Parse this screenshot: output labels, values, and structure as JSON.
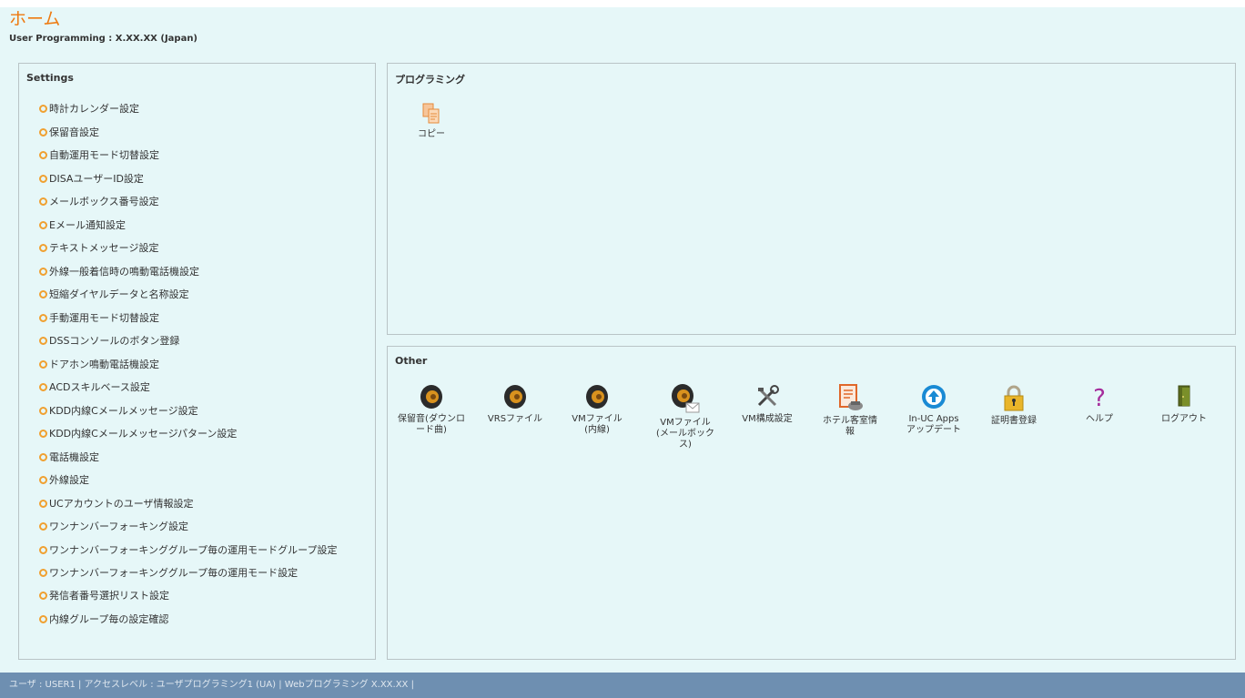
{
  "header": {
    "title": "ホーム",
    "subtitle": "User Programming : X.XX.XX (Japan)"
  },
  "settings": {
    "title": "Settings",
    "items": [
      {
        "label": "時計カレンダー設定"
      },
      {
        "label": "保留音設定"
      },
      {
        "label": "自動運用モード切替設定"
      },
      {
        "label": "DISAユーザーID設定"
      },
      {
        "label": "メールボックス番号設定"
      },
      {
        "label": "Eメール通知設定"
      },
      {
        "label": "テキストメッセージ設定"
      },
      {
        "label": "外線一般着信時の鳴動電話機設定"
      },
      {
        "label": "短縮ダイヤルデータと名称設定"
      },
      {
        "label": "手動運用モード切替設定"
      },
      {
        "label": "DSSコンソールのボタン登録"
      },
      {
        "label": "ドアホン鳴動電話機設定"
      },
      {
        "label": "ACDスキルベース設定"
      },
      {
        "label": "KDD内線Cメールメッセージ設定"
      },
      {
        "label": "KDD内線Cメールメッセージパターン設定"
      },
      {
        "label": "電話機設定"
      },
      {
        "label": "外線設定"
      },
      {
        "label": "UCアカウントのユーザ情報設定"
      },
      {
        "label": "ワンナンバーフォーキング設定"
      },
      {
        "label": "ワンナンバーフォーキンググループ毎の運用モードグループ設定"
      },
      {
        "label": "ワンナンバーフォーキンググループ毎の運用モード設定"
      },
      {
        "label": "発信者番号選択リスト設定"
      },
      {
        "label": "内線グループ毎の設定確認"
      }
    ]
  },
  "programming": {
    "title": "プログラミング",
    "items": [
      {
        "label": "コピー",
        "icon": "copy-icon"
      }
    ]
  },
  "other": {
    "title": "Other",
    "items": [
      {
        "label": "保留音(ダウンロード曲)",
        "icon": "speaker-icon"
      },
      {
        "label": "VRSファイル",
        "icon": "speaker-icon"
      },
      {
        "label": "VMファイル(内線)",
        "icon": "speaker-icon"
      },
      {
        "label": "VMファイル(メールボックス)",
        "icon": "speaker-mail-icon"
      },
      {
        "label": "VM構成設定",
        "icon": "tools-icon"
      },
      {
        "label": "ホテル客室情報",
        "icon": "hotel-info-icon"
      },
      {
        "label": "In-UC Apps アップデート",
        "icon": "update-icon"
      },
      {
        "label": "証明書登録",
        "icon": "lock-icon"
      },
      {
        "label": "ヘルプ",
        "icon": "help-icon"
      },
      {
        "label": "ログアウト",
        "icon": "logout-icon"
      }
    ]
  },
  "statusbar": {
    "text": "ユーザ : USER1 | アクセスレベル : ユーザプログラミング1 (UA) | Webプログラミング X.XX.XX |"
  },
  "colors": {
    "accent": "#ee7a10",
    "background": "#e6f7f8",
    "statusbar": "#6e8fb1"
  }
}
